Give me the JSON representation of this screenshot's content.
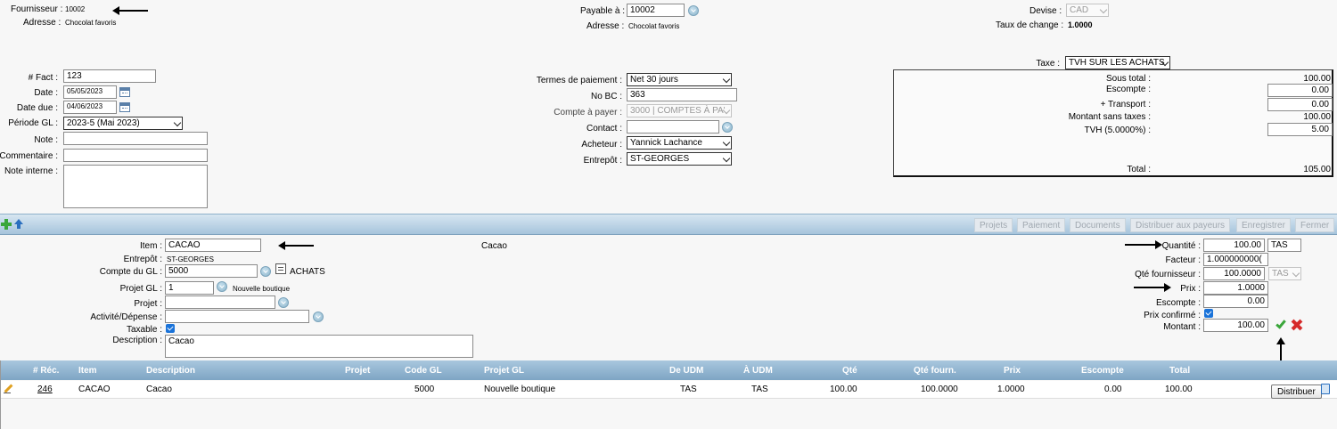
{
  "header": {
    "supplier_label": "Fournisseur :",
    "supplier_value": "10002",
    "address_label": "Adresse :",
    "address_value": "Chocolat favoris",
    "payable_label": "Payable à :",
    "payable_value": "10002",
    "payable_address_label": "Adresse :",
    "payable_address_value": "Chocolat favoris",
    "currency_label": "Devise :",
    "currency_value": "CAD",
    "rate_label": "Taux de change :",
    "rate_value": "1.0000"
  },
  "invoice": {
    "num_label": "# Fact :",
    "num_value": "123",
    "date_label": "Date :",
    "date_value": "05/05/2023",
    "due_label": "Date due :",
    "due_value": "04/06/2023",
    "period_label": "Période GL :",
    "period_value": "2023-5 (Mai 2023)",
    "note_label": "Note :",
    "note_value": "",
    "comment_label": "Commentaire :",
    "comment_value": "",
    "internal_label": "Note interne :",
    "internal_value": ""
  },
  "terms": {
    "terms_label": "Termes de paiement :",
    "terms_value": "Net 30 jours",
    "po_label": "No BC :",
    "po_value": "363",
    "ap_label": "Compte à payer :",
    "ap_value": "3000 | COMPTES À PA'",
    "contact_label": "Contact :",
    "contact_value": "",
    "buyer_label": "Acheteur :",
    "buyer_value": "Yannick Lachance",
    "warehouse_label": "Entrepôt :",
    "warehouse_value": "ST-GEORGES"
  },
  "tax": {
    "tax_label": "Taxe :",
    "tax_value": "TVH SUR LES ACHATS",
    "subtotal_label": "Sous total :",
    "subtotal_value": "100.00",
    "discount_label": "Escompte :",
    "discount_value": "0.00",
    "transport_label": "+ Transport :",
    "transport_value": "0.00",
    "notax_label": "Montant sans taxes :",
    "notax_value": "100.00",
    "tvh_label": "TVH (5.0000%) :",
    "tvh_value": "5.00",
    "total_label": "Total :",
    "total_value": "105.00"
  },
  "toolbar": {
    "buttons": [
      "Projets",
      "Paiement",
      "Documents",
      "Distribuer aux payeurs",
      "Enregistrer",
      "Fermer"
    ]
  },
  "item": {
    "item_label": "Item :",
    "item_value": "CACAO",
    "item_desc": "Cacao",
    "warehouse_label": "Entrepôt :",
    "warehouse_value": "ST-GEORGES",
    "gl_label": "Compte du GL :",
    "gl_value": "5000",
    "gl_name": "ACHATS",
    "project_gl_label": "Projet GL :",
    "project_gl_value": "1",
    "project_gl_name": "Nouvelle boutique",
    "project_label": "Projet :",
    "project_value": "",
    "activity_label": "Activité/Dépense :",
    "activity_value": "",
    "taxable_label": "Taxable :",
    "desc_label": "Description :",
    "desc_value": "Cacao",
    "qty_label": "Quantité :",
    "qty_value": "100.00",
    "qty_unit": "TAS",
    "factor_label": "Facteur :",
    "factor_value": "1.000000000(",
    "sup_qty_label": "Qté fournisseur :",
    "sup_qty_value": "100.0000",
    "sup_qty_unit": "TAS",
    "price_label": "Prix :",
    "price_value": "1.0000",
    "discount_label": "Escompte :",
    "discount_value": "0.00",
    "confirmed_label": "Prix confirmé :",
    "amount_label": "Montant :",
    "amount_value": "100.00"
  },
  "grid": {
    "headers": [
      "# Réc.",
      "Item",
      "Description",
      "Projet",
      "Code GL",
      "Projet GL",
      "De UDM",
      "À UDM",
      "Qté",
      "Qté fourn.",
      "Prix",
      "Escompte",
      "Total"
    ],
    "rows": [
      {
        "rec": "246",
        "item": "CACAO",
        "desc": "Cacao",
        "project": "",
        "gl": "5000",
        "project_gl": "Nouvelle boutique",
        "from_uom": "TAS",
        "to_uom": "TAS",
        "qty": "100.00",
        "sup_qty": "100.0000",
        "price": "1.0000",
        "discount": "0.00",
        "total": "100.00"
      }
    ],
    "distribute_label": "Distribuer"
  }
}
